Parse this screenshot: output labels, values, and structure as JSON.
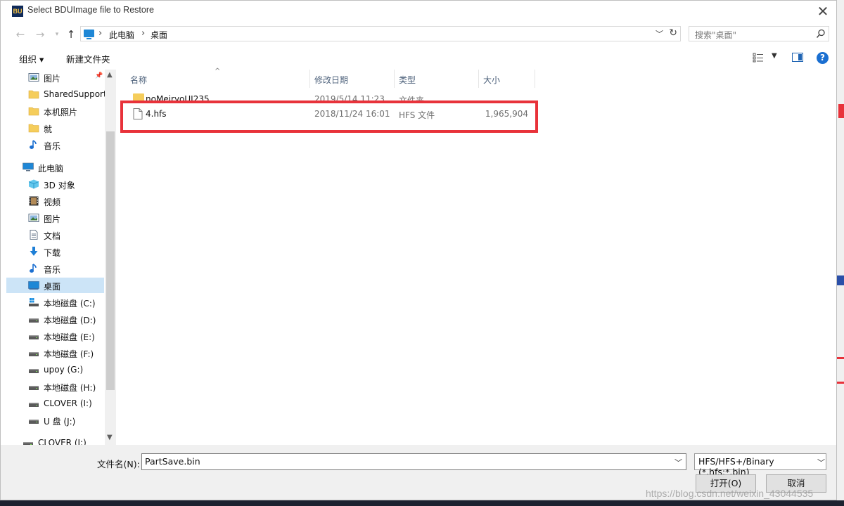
{
  "window": {
    "title": "Select BDUImage file to Restore",
    "app_icon_text": "BU",
    "close": "✕"
  },
  "address": {
    "breadcrumbs": [
      "此电脑",
      "桌面"
    ],
    "search_placeholder": "搜索\"桌面\""
  },
  "toolbar": {
    "organize": "组织 ▾",
    "new_folder": "新建文件夹",
    "help": "?"
  },
  "sidebar": {
    "items": [
      {
        "label": "图片",
        "icon": "pictures-icon",
        "pinned": true
      },
      {
        "label": "SharedSupport",
        "icon": "folder-icon"
      },
      {
        "label": "本机照片",
        "icon": "folder-icon"
      },
      {
        "label": "就",
        "icon": "folder-icon"
      },
      {
        "label": "音乐",
        "icon": "music-icon"
      },
      {
        "label": "此电脑",
        "icon": "computer-icon"
      },
      {
        "label": "3D 对象",
        "icon": "3d-objects-icon"
      },
      {
        "label": "视频",
        "icon": "video-icon"
      },
      {
        "label": "图片",
        "icon": "pictures-icon"
      },
      {
        "label": "文档",
        "icon": "documents-icon"
      },
      {
        "label": "下载",
        "icon": "download-icon"
      },
      {
        "label": "音乐",
        "icon": "music-icon"
      },
      {
        "label": "桌面",
        "icon": "desktop-icon",
        "selected": true
      },
      {
        "label": "本地磁盘 (C:)",
        "icon": "system-drive-icon"
      },
      {
        "label": "本地磁盘 (D:)",
        "icon": "drive-icon"
      },
      {
        "label": "本地磁盘 (E:)",
        "icon": "drive-icon"
      },
      {
        "label": "本地磁盘 (F:)",
        "icon": "drive-icon"
      },
      {
        "label": "upoy (G:)",
        "icon": "drive-icon"
      },
      {
        "label": "本地磁盘 (H:)",
        "icon": "drive-icon"
      },
      {
        "label": "CLOVER (I:)",
        "icon": "drive-icon"
      },
      {
        "label": "U 盘 (J:)",
        "icon": "drive-icon"
      },
      {
        "label": "CLOVER (I:)",
        "icon": "drive-icon"
      }
    ]
  },
  "columns": {
    "name": "名称",
    "date": "修改日期",
    "type": "类型",
    "size": "大小"
  },
  "files": [
    {
      "name": "noMeiryoUI235",
      "date": "2019/5/14 11:23",
      "type": "文件夹",
      "size": "",
      "kind": "folder"
    },
    {
      "name": "4.hfs",
      "date": "2018/11/24 16:01",
      "type": "HFS 文件",
      "size": "1,965,904",
      "kind": "file"
    }
  ],
  "bottom": {
    "filename_label": "文件名(N):",
    "filename_value": "PartSave.bin",
    "filter": "HFS/HFS+/Binary (*.hfs;*.bin)",
    "open": "打开(O)",
    "cancel": "取消"
  },
  "watermark": "https://blog.csdn.net/weixin_43044535",
  "colors": {
    "highlight": "#e8323a",
    "selection": "#cce4f7",
    "accent": "#1a6fd1"
  }
}
